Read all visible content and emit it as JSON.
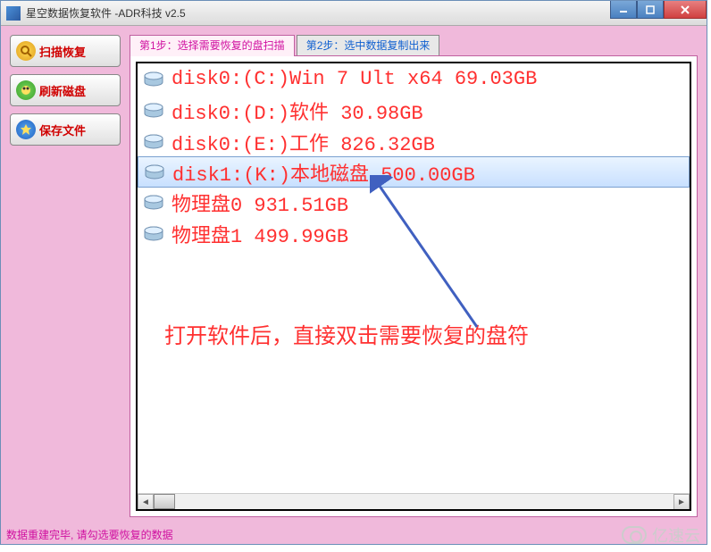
{
  "window": {
    "title": "星空数据恢复软件   -ADR科技 v2.5"
  },
  "sidebar": {
    "scan_label": "扫描恢复",
    "refresh_label": "刷新磁盘",
    "save_label": "保存文件"
  },
  "tabs": {
    "step1": "第1步：选择需要恢复的盘扫描",
    "step2": "第2步：选中数据复制出来"
  },
  "disks": [
    {
      "label": "disk0:(C:)Win 7 Ult x64 69.03GB",
      "selected": false
    },
    {
      "label": "disk0:(D:)软件 30.98GB",
      "selected": false
    },
    {
      "label": "disk0:(E:)工作 826.32GB",
      "selected": false
    },
    {
      "label": "disk1:(K:)本地磁盘 500.00GB",
      "selected": true
    },
    {
      "label": "物理盘0 931.51GB",
      "selected": false
    },
    {
      "label": "物理盘1 499.99GB",
      "selected": false
    }
  ],
  "annotation": "打开软件后，直接双击需要恢复的盘符",
  "statusbar": "数据重建完毕, 请勾选要恢复的数据",
  "watermark": "亿速云"
}
